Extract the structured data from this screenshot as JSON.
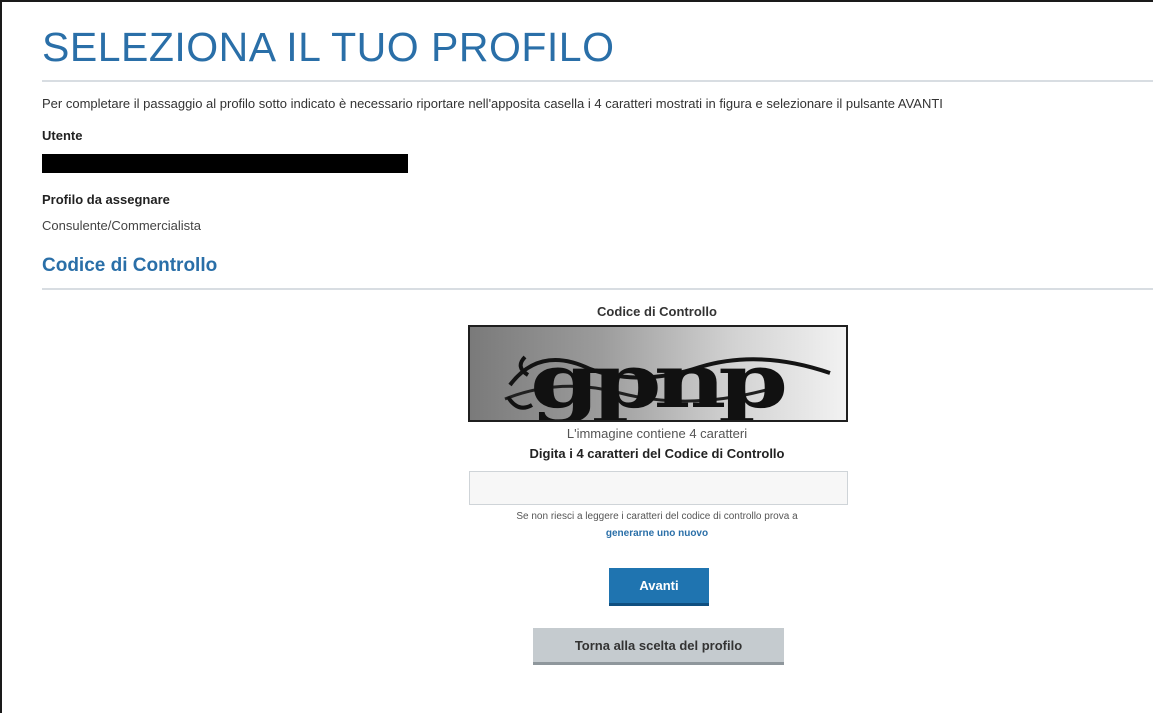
{
  "header": {
    "title": "SELEZIONA IL TUO PROFILO",
    "intro": "Per completare il passaggio al profilo sotto indicato è necessario riportare nell'apposita casella i 4 caratteri mostrati in figura e selezionare il pulsante AVANTI"
  },
  "user": {
    "label": "Utente"
  },
  "profile": {
    "label": "Profilo da assegnare",
    "value": "Consulente/Commercialista"
  },
  "captcha": {
    "section_title": "Codice di Controllo",
    "heading": "Codice di Controllo",
    "image_text": "gpnp",
    "note": "L'immagine contiene 4 caratteri",
    "instruction": "Digita i 4 caratteri del Codice di Controllo",
    "input_value": "",
    "input_placeholder": "",
    "help_text": "Se non riesci a leggere i caratteri del codice di controllo prova a",
    "help_link": "generarne uno nuovo"
  },
  "actions": {
    "next_label": "Avanti",
    "back_label": "Torna alla scelta del profilo"
  },
  "colors": {
    "accent": "#2a6fa8",
    "primary_button": "#1f74b0",
    "secondary_button": "#c5cbcf"
  }
}
